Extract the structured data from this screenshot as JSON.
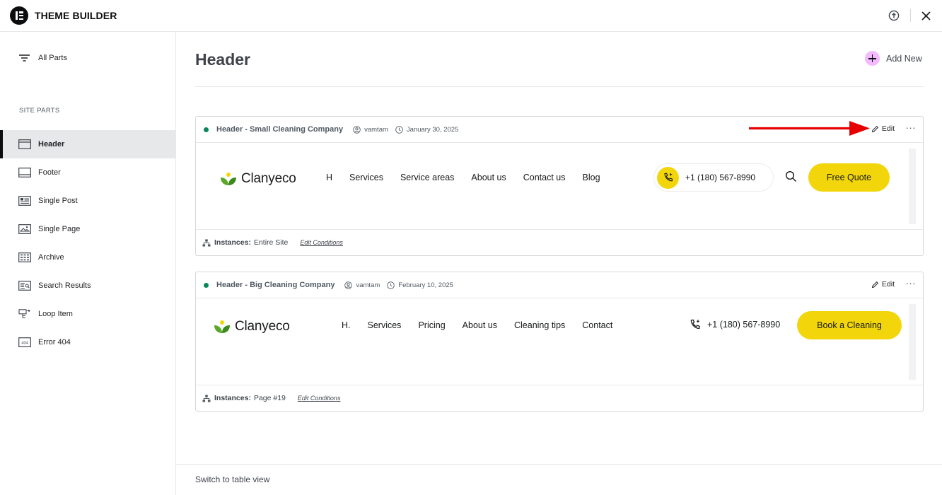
{
  "app": {
    "title": "THEME BUILDER"
  },
  "sidebar": {
    "all_parts": "All Parts",
    "section_heading": "SITE PARTS",
    "items": [
      {
        "label": "Header",
        "icon": "header-icon",
        "active": true
      },
      {
        "label": "Footer",
        "icon": "footer-icon"
      },
      {
        "label": "Single Post",
        "icon": "single-post-icon"
      },
      {
        "label": "Single Page",
        "icon": "single-page-icon"
      },
      {
        "label": "Archive",
        "icon": "archive-icon"
      },
      {
        "label": "Search Results",
        "icon": "search-results-icon"
      },
      {
        "label": "Loop Item",
        "icon": "loop-item-icon"
      },
      {
        "label": "Error 404",
        "icon": "error-404-icon"
      }
    ]
  },
  "main": {
    "title": "Header",
    "add_new": "Add New",
    "cards": [
      {
        "title": "Header - Small Cleaning Company",
        "author": "vamtam",
        "date": "January 30, 2025",
        "edit": "Edit",
        "preview": {
          "brand": "Clanyeco",
          "nav": [
            "H",
            "Services",
            "Service areas",
            "About us",
            "Contact us",
            "Blog"
          ],
          "phone": "+1 (180) 567-8990",
          "cta": "Free Quote"
        },
        "instances_label": "Instances:",
        "instances_value": "Entire Site",
        "edit_conditions": "Edit Conditions"
      },
      {
        "title": "Header - Big Cleaning Company",
        "author": "vamtam",
        "date": "February 10, 2025",
        "edit": "Edit",
        "preview": {
          "brand": "Clanyeco",
          "nav": [
            "H.",
            "Services",
            "Pricing",
            "About us",
            "Cleaning tips",
            "Contact"
          ],
          "phone": "+1 (180) 567-8990",
          "cta": "Book a Cleaning"
        },
        "instances_label": "Instances:",
        "instances_value": "Page #19",
        "edit_conditions": "Edit Conditions"
      }
    ]
  },
  "footer": {
    "table_view": "Switch to table view"
  },
  "colors": {
    "accent_yellow": "#f2d60b",
    "status_green": "#0a875a",
    "add_pink": "#f3bafd",
    "arrow_red": "#e60000"
  }
}
